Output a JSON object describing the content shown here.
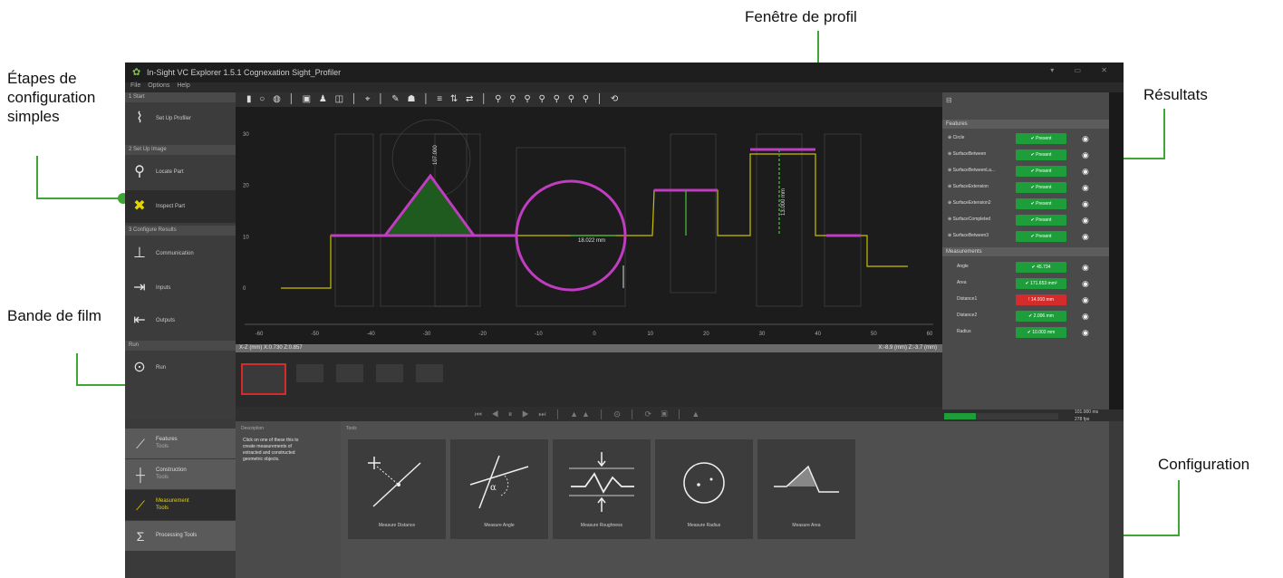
{
  "callouts": {
    "steps": "Étapes de configuration simples",
    "filmstrip": "Bande de film",
    "profile": "Fenêtre de profil",
    "results": "Résultats",
    "configuration": "Configuration"
  },
  "app": {
    "title": "In-Sight VC Explorer 1.5.1   Cognexation Sight_Profiler",
    "menu": [
      "File",
      "Options",
      "Help"
    ],
    "colors": {
      "accent_green": "#3fa535",
      "profile_magenta": "#c03cc0",
      "profile_yellow": "#c8c000",
      "pass_green": "#1e9e3a",
      "fail_red": "#d42b2b"
    }
  },
  "steps": {
    "sections": [
      "1 Start",
      "2 Set Up Image",
      "3 Configure Results",
      "Run"
    ],
    "items": [
      {
        "label": "Set Up Profiler",
        "icon": "profiler-icon"
      },
      {
        "label": "Locate Part",
        "icon": "magnifier-icon"
      },
      {
        "label": "Inspect Part",
        "icon": "tools-icon"
      },
      {
        "label": "Communication",
        "icon": "communication-icon"
      },
      {
        "label": "Inputs",
        "icon": "inputs-icon"
      },
      {
        "label": "Outputs",
        "icon": "outputs-icon"
      },
      {
        "label": "Run",
        "icon": "play-icon"
      }
    ]
  },
  "profile": {
    "status_left": "X-Z (mm)  X:0.730  Z:0.857",
    "status_right": "X:-8.9 (mm)  Z:-3.7 (mm)",
    "x_ticks": [
      "-60",
      "-50",
      "-40",
      "-30",
      "-20",
      "-10",
      "0",
      "10",
      "20",
      "30",
      "40",
      "50",
      "60"
    ],
    "y_ticks": [
      "30",
      "20",
      "10",
      "0"
    ],
    "labels": {
      "circle_dim": "18.022 mm",
      "area_label": "107.000",
      "height_label": "13.000 mm"
    }
  },
  "results": {
    "sections": [
      "Features",
      "Measurements"
    ],
    "features": [
      {
        "name": "Circle",
        "status": "Present"
      },
      {
        "name": "SurfaceBetween",
        "status": "Present"
      },
      {
        "name": "SurfaceBetweenLa...",
        "status": "Present"
      },
      {
        "name": "SurfaceExtension",
        "status": "Present"
      },
      {
        "name": "SurfaceExtension2",
        "status": "Present"
      },
      {
        "name": "SurfaceCompleted",
        "status": "Present"
      },
      {
        "name": "SurfaceBetween3",
        "status": "Present"
      }
    ],
    "measurements": [
      {
        "name": "Angle",
        "value": "45.734",
        "state": "pass"
      },
      {
        "name": "Area",
        "value": "171.653 mm²",
        "state": "pass"
      },
      {
        "name": "Distance1",
        "value": "14.910 mm",
        "state": "fail"
      },
      {
        "name": "Distance2",
        "value": "2.006 mm",
        "state": "pass"
      },
      {
        "name": "Radius",
        "value": "10.003 mm",
        "state": "pass"
      }
    ],
    "footer": [
      "101.000 ms",
      "278 fps"
    ]
  },
  "tools": {
    "categories": [
      {
        "name": "Features",
        "sub": "Tools",
        "icon": "feature-tool-icon"
      },
      {
        "name": "Construction",
        "sub": "Tools",
        "icon": "construction-tool-icon"
      },
      {
        "name": "Measurement",
        "sub": "Tools",
        "icon": "measurement-tool-icon"
      },
      {
        "name": "Processing Tools",
        "sub": "",
        "icon": "sigma-icon"
      }
    ],
    "description_header": "Description",
    "description": "Click on one of these this to create measurements of extracted and constructed geometric objects.",
    "tools_header": "Tools",
    "cards": [
      {
        "label": "Measure Distance",
        "icon": "distance-icon"
      },
      {
        "label": "Measure Angle",
        "icon": "angle-icon"
      },
      {
        "label": "Measure Roughness",
        "icon": "roughness-icon"
      },
      {
        "label": "Measure Radius",
        "icon": "radius-icon"
      },
      {
        "label": "Measure Area",
        "icon": "area-icon"
      }
    ]
  }
}
